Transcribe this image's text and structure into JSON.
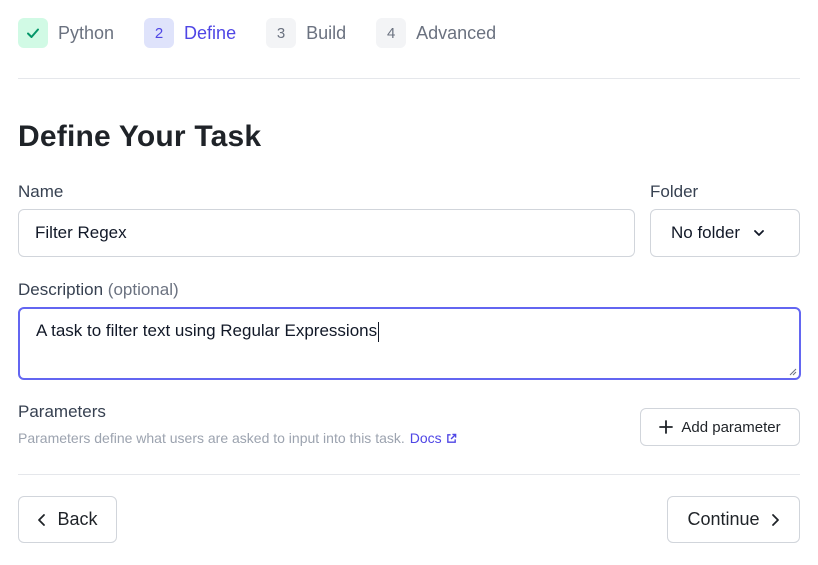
{
  "stepper": {
    "steps": [
      {
        "badge": "",
        "label": "Python",
        "state": "done",
        "icon": "check-icon"
      },
      {
        "badge": "2",
        "label": "Define",
        "state": "active"
      },
      {
        "badge": "3",
        "label": "Build",
        "state": "upcoming"
      },
      {
        "badge": "4",
        "label": "Advanced",
        "state": "upcoming"
      }
    ]
  },
  "page": {
    "title": "Define Your Task"
  },
  "form": {
    "name": {
      "label": "Name",
      "value": "Filter Regex"
    },
    "folder": {
      "label": "Folder",
      "value": "No folder",
      "icon": "chevron-down-icon"
    },
    "description": {
      "label": "Description",
      "optional_label": "(optional)",
      "value": "A task to filter text using Regular Expressions"
    },
    "parameters": {
      "title": "Parameters",
      "help_text": "Parameters define what users are asked to input into this task.",
      "docs_link": "Docs",
      "add_button": "Add parameter"
    }
  },
  "footer": {
    "back_label": "Back",
    "continue_label": "Continue"
  },
  "colors": {
    "accent": "#4f46e5",
    "focus_border": "#6366f1",
    "done_badge_bg": "#d1fae5",
    "done_check": "#059669"
  }
}
